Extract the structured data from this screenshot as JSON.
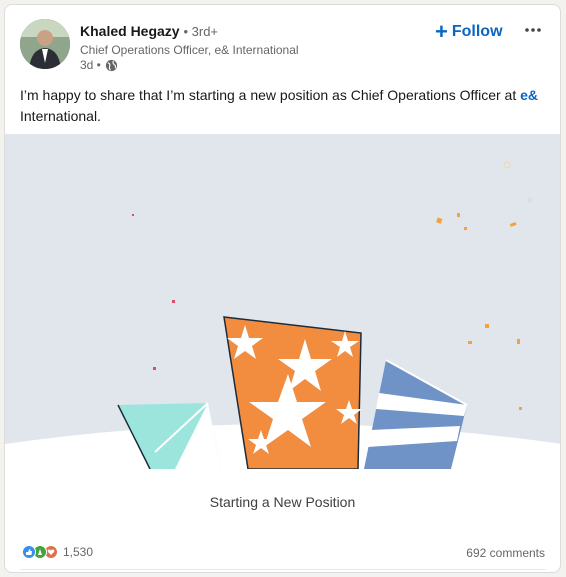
{
  "author": {
    "name": "Khaled Hegazy",
    "degree": "• 3rd+",
    "headline": "Chief Operations Officer, e& International",
    "time": "3d •"
  },
  "actions": {
    "follow_label": "Follow",
    "follow_icon": "plus-icon",
    "more_icon": "ellipsis-icon"
  },
  "post": {
    "text_before": "I’m happy to share that I’m starting a new position as Chief Operations Officer at ",
    "mention": "e&",
    "text_after": " International."
  },
  "image": {
    "caption": "Starting a New Position"
  },
  "social": {
    "reaction_count": "1,530",
    "comments": "692 comments",
    "reaction_icons": [
      "like-icon",
      "celebrate-icon",
      "love-icon"
    ]
  },
  "colors": {
    "brand_blue": "#0a66c2",
    "image_bg": "#e1e6ec",
    "orange": "#f28c3f",
    "teal": "#9be5dd",
    "blue_panel": "#6f92c7"
  }
}
